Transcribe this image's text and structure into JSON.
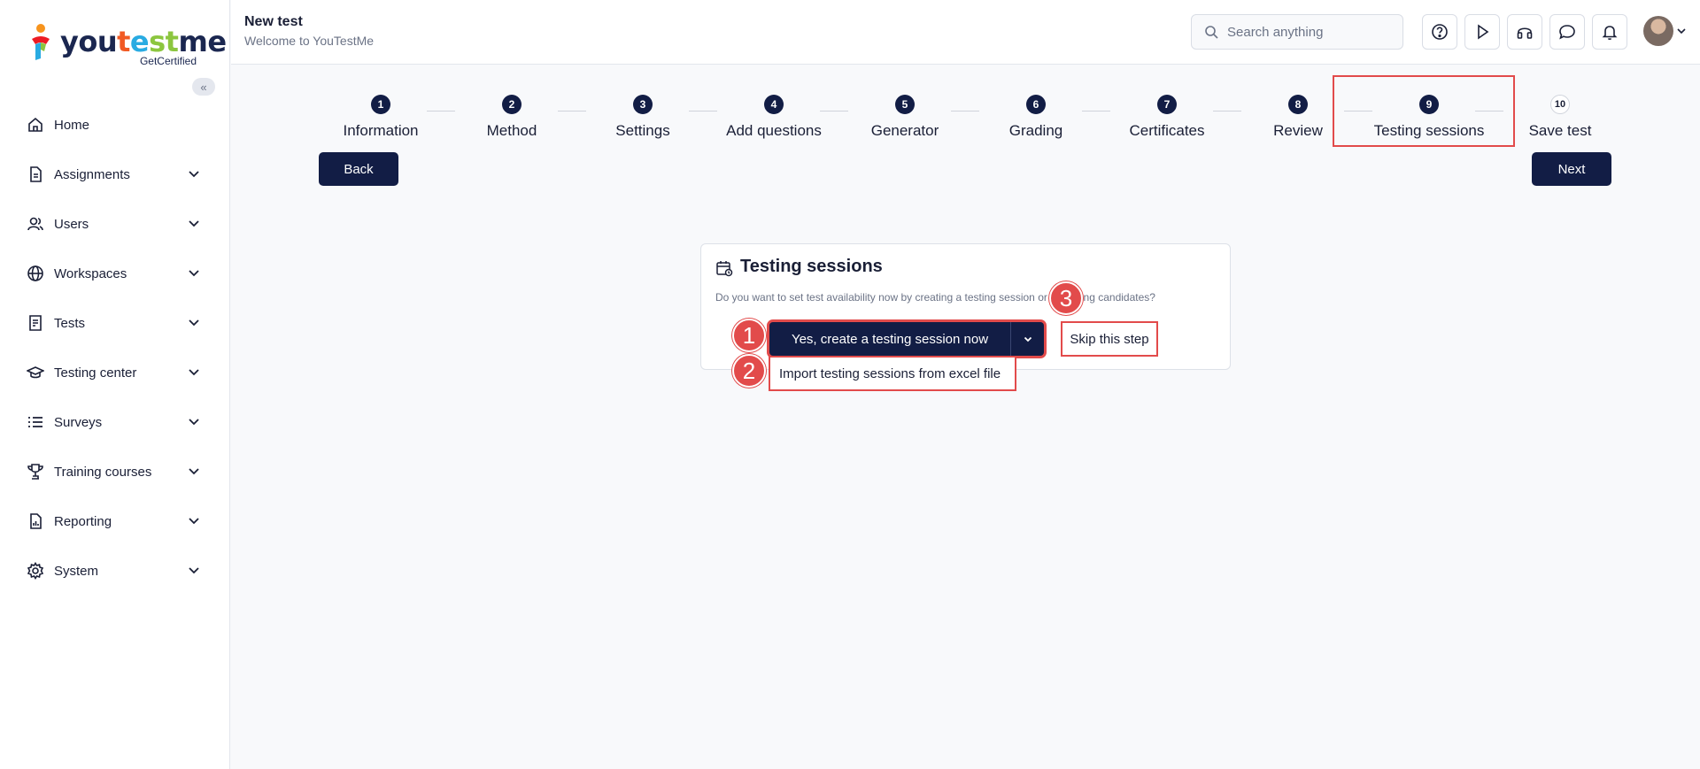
{
  "brand": {
    "name_part1": "you",
    "name_part2": "t",
    "name_part3": "e",
    "name_part4": "st",
    "name_part5": "me",
    "subtitle": "GetCertified"
  },
  "sidebar": {
    "collapse_icon": "«",
    "items": [
      {
        "label": "Home",
        "icon": "home-icon"
      },
      {
        "label": "Assignments",
        "icon": "document-icon"
      },
      {
        "label": "Users",
        "icon": "users-icon"
      },
      {
        "label": "Workspaces",
        "icon": "globe-icon"
      },
      {
        "label": "Tests",
        "icon": "checklist-icon"
      },
      {
        "label": "Testing center",
        "icon": "graduation-cap-icon"
      },
      {
        "label": "Surveys",
        "icon": "list-icon"
      },
      {
        "label": "Training courses",
        "icon": "trophy-icon"
      },
      {
        "label": "Reporting",
        "icon": "report-icon"
      },
      {
        "label": "System",
        "icon": "gear-icon"
      }
    ]
  },
  "header": {
    "title": "New test",
    "subtitle": "Welcome to YouTestMe",
    "search_placeholder": "Search anything"
  },
  "stepper": {
    "steps": [
      {
        "num": "1",
        "label": "Information"
      },
      {
        "num": "2",
        "label": "Method"
      },
      {
        "num": "3",
        "label": "Settings"
      },
      {
        "num": "4",
        "label": "Add questions"
      },
      {
        "num": "5",
        "label": "Generator"
      },
      {
        "num": "6",
        "label": "Grading"
      },
      {
        "num": "7",
        "label": "Certificates"
      },
      {
        "num": "8",
        "label": "Review"
      },
      {
        "num": "9",
        "label": "Testing sessions"
      },
      {
        "num": "10",
        "label": "Save test"
      }
    ],
    "back_label": "Back",
    "next_label": "Next"
  },
  "card": {
    "title": "Testing sessions",
    "description": "Do you want to set test availability now by creating a testing session or assigning candidates?",
    "primary_label": "Yes, create a testing session now",
    "dropdown_item": "Import testing sessions from excel file",
    "skip_label": "Skip this step"
  },
  "annotations": [
    "1",
    "2",
    "3"
  ],
  "colors": {
    "primary": "#121d45",
    "highlight": "#e24b4b"
  }
}
